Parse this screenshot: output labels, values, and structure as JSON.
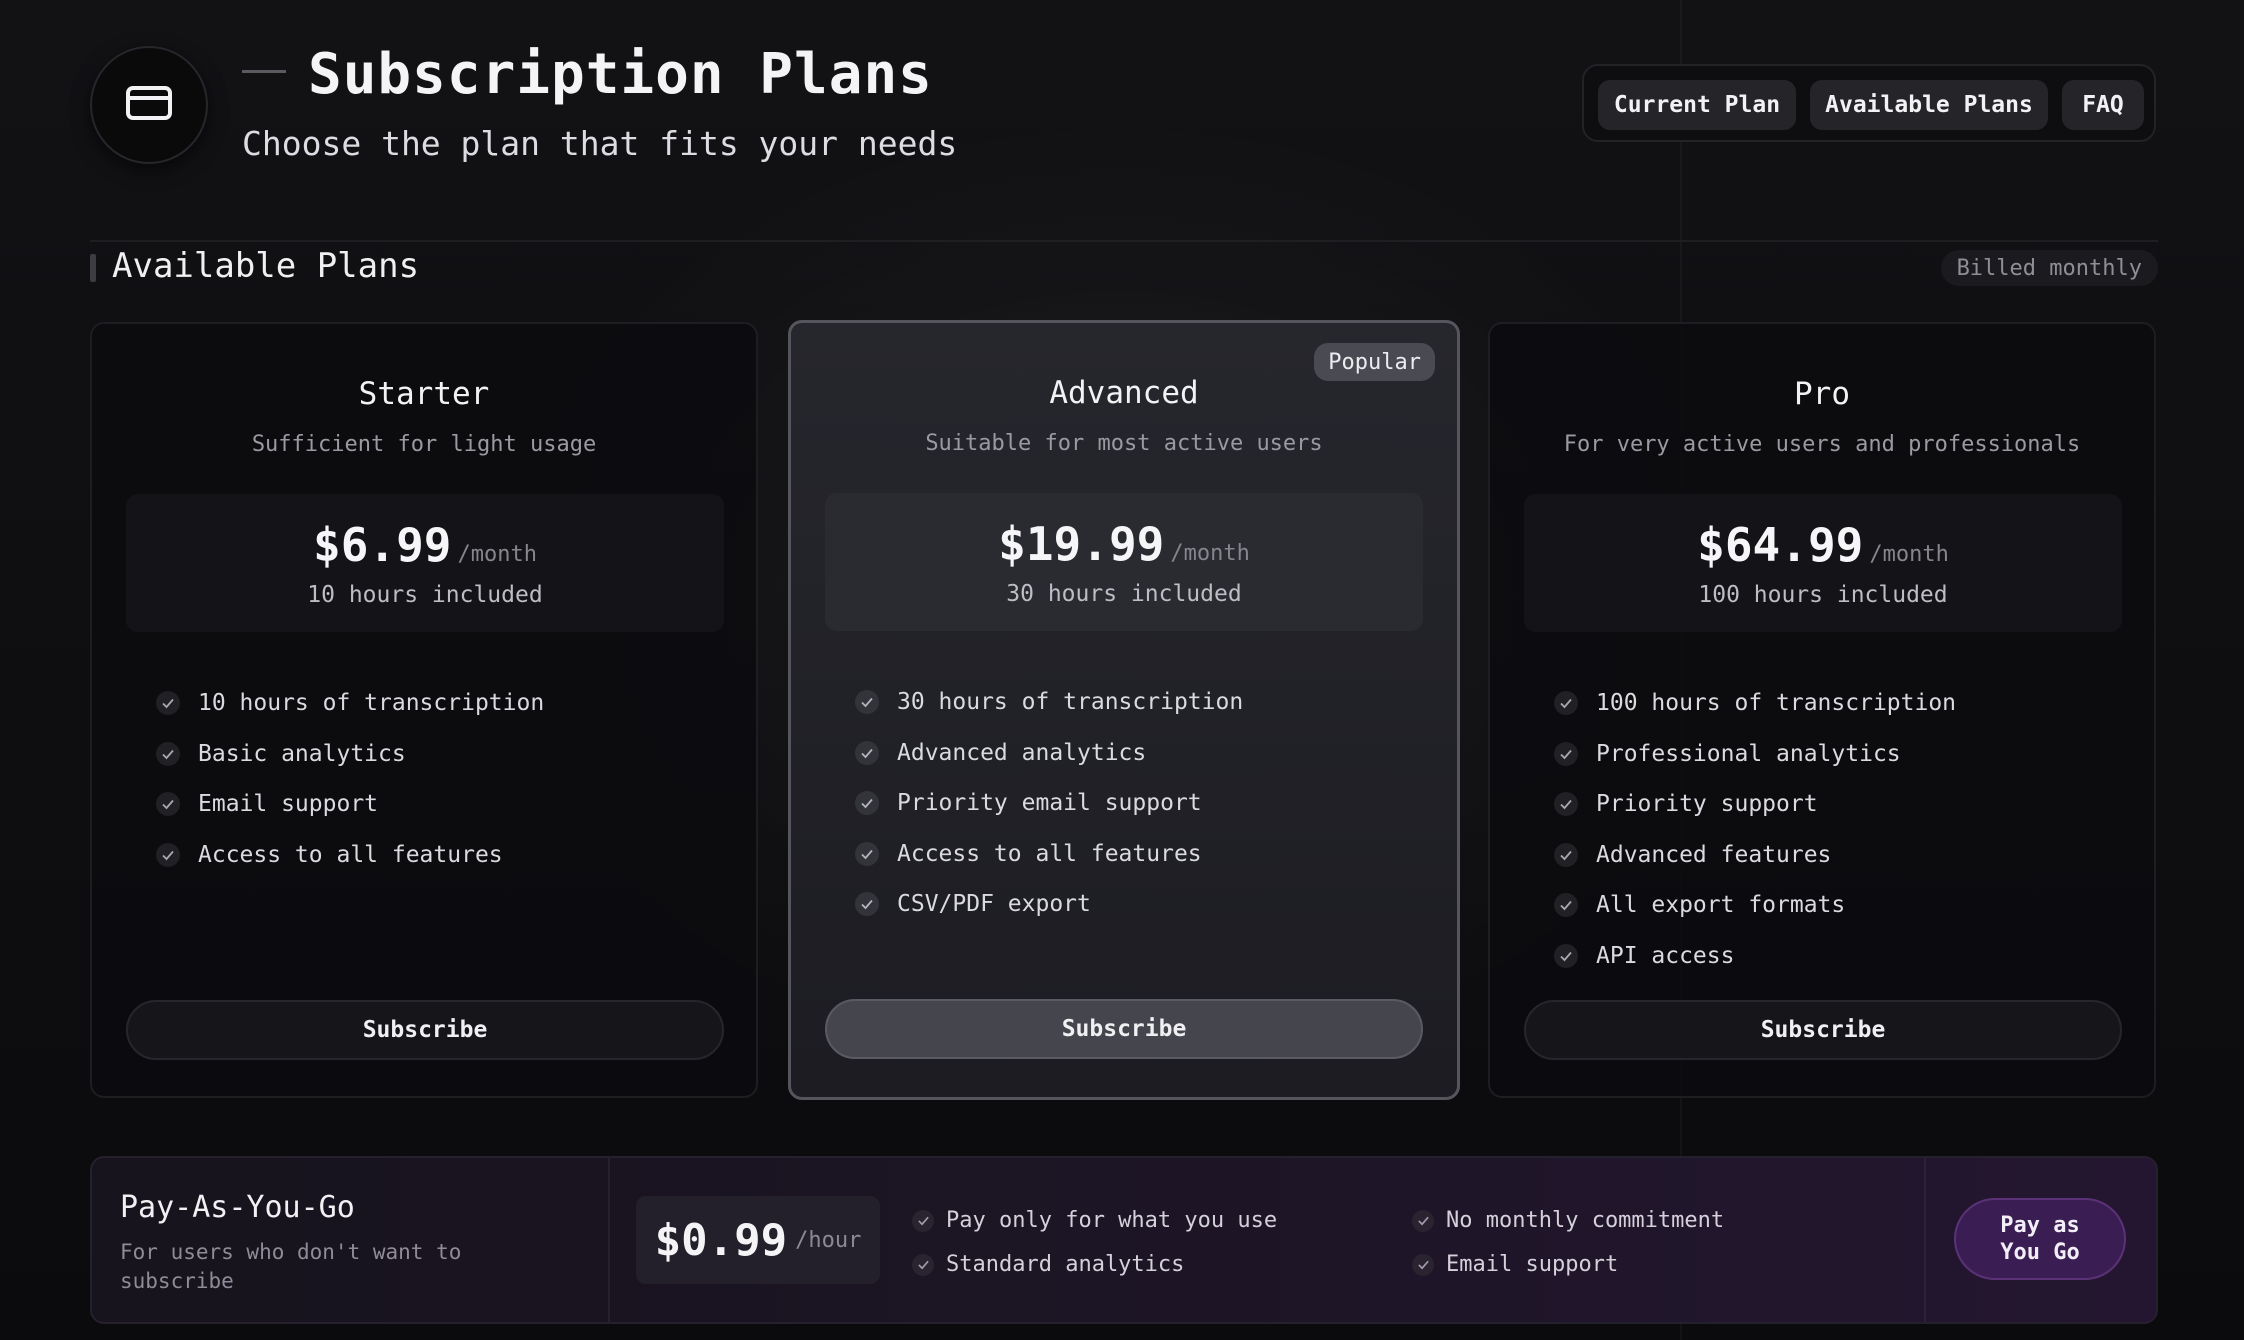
{
  "header": {
    "title": "Subscription Plans",
    "subtitle": "Choose the plan that fits your needs",
    "logo_icon": "credit-card-icon",
    "nav": [
      "Current Plan",
      "Available Plans",
      "FAQ"
    ]
  },
  "section": {
    "title": "Available Plans",
    "billing": "Billed monthly"
  },
  "plans": [
    {
      "name": "Starter",
      "description": "Sufficient for light usage",
      "price": "$6.99",
      "unit": "/month",
      "hours": "10 hours included",
      "features": [
        "10 hours of transcription",
        "Basic analytics",
        "Email support",
        "Access to all features"
      ],
      "button": "Subscribe"
    },
    {
      "name": "Advanced",
      "badge": "Popular",
      "description": "Suitable for most active users",
      "price": "$19.99",
      "unit": "/month",
      "hours": "30 hours included",
      "features": [
        "30 hours of transcription",
        "Advanced analytics",
        "Priority email support",
        "Access to all features",
        "CSV/PDF export"
      ],
      "button": "Subscribe"
    },
    {
      "name": "Pro",
      "description": "For very active users and professionals",
      "price": "$64.99",
      "unit": "/month",
      "hours": "100 hours included",
      "features": [
        "100 hours of transcription",
        "Professional analytics",
        "Priority support",
        "Advanced features",
        "All export formats",
        "API access"
      ],
      "button": "Subscribe"
    }
  ],
  "payg": {
    "title": "Pay-As-You-Go",
    "description": "For users who don't want to subscribe",
    "price": "$0.99",
    "unit": "/hour",
    "features": [
      "Pay only for what you use",
      "No monthly commitment",
      "Standard analytics",
      "Email support"
    ],
    "button": "Pay as You Go"
  },
  "colors": {
    "background": "#0b0b0d",
    "accent_purple": "#3a1d52"
  }
}
